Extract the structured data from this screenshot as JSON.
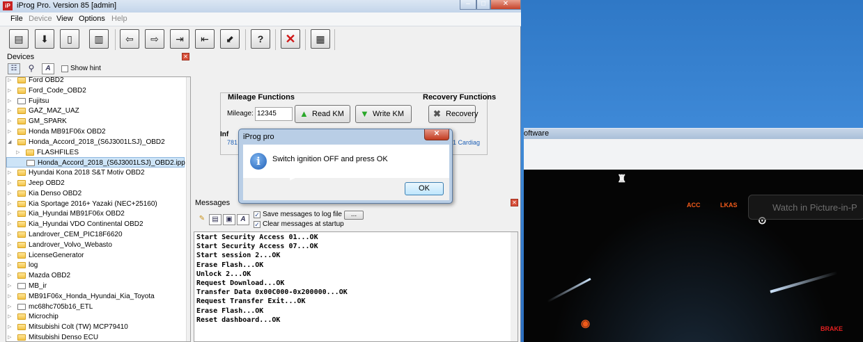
{
  "app": {
    "title": "iProg Pro. Version 85 [admin]",
    "icon_text": "iP"
  },
  "window_controls": {
    "minimize": "–",
    "maximize": "□",
    "close": "✕"
  },
  "menu": [
    "File",
    "Device",
    "View",
    "Options",
    "Help"
  ],
  "toolbar": {
    "icons": [
      "open-icon",
      "save-icon",
      "new-file-icon",
      "chip-icon",
      "read-icon",
      "write-icon",
      "edit-icon",
      "import-icon",
      "export-icon",
      "help-icon",
      "delete-icon",
      "calculator-icon"
    ],
    "help_glyph": "?",
    "delete_glyph": "✕"
  },
  "devices": {
    "header": "Devices",
    "show_hint": "Show hint",
    "items": [
      {
        "label": "Ford OBD2",
        "type": "folder",
        "indent": 0
      },
      {
        "label": "Ford_Code_OBD2",
        "type": "folder",
        "indent": 0
      },
      {
        "label": "Fujitsu",
        "type": "file",
        "indent": 0
      },
      {
        "label": "GAZ_MAZ_UAZ",
        "type": "folder",
        "indent": 0
      },
      {
        "label": "GM_SPARK",
        "type": "folder",
        "indent": 0
      },
      {
        "label": "Honda MB91F06x OBD2",
        "type": "folder",
        "indent": 0
      },
      {
        "label": "Honda_Accord_2018_(S6J3001LSJ)_OBD2",
        "type": "folder",
        "indent": 0,
        "expanded": true
      },
      {
        "label": "FLASHFILES",
        "type": "folder",
        "indent": 1
      },
      {
        "label": "Honda_Accord_2018_(S6J3001LSJ)_OBD2.ipp",
        "type": "ipp",
        "indent": 1,
        "selected": true
      },
      {
        "label": "Hyundai Kona 2018 S&T Motiv OBD2",
        "type": "folder",
        "indent": 0
      },
      {
        "label": "Jeep OBD2",
        "type": "folder",
        "indent": 0
      },
      {
        "label": "Kia Denso OBD2",
        "type": "folder",
        "indent": 0
      },
      {
        "label": "Kia Sportage 2016+ Yazaki (NEC+25160)",
        "type": "folder",
        "indent": 0
      },
      {
        "label": "Kia_Hyundai MB91F06x OBD2",
        "type": "folder",
        "indent": 0
      },
      {
        "label": "Kia_Hyundai VDO Continental OBD2",
        "type": "folder",
        "indent": 0
      },
      {
        "label": "Landrover_CEM_PIC18F6620",
        "type": "folder",
        "indent": 0
      },
      {
        "label": "Landrover_Volvo_Webasto",
        "type": "folder",
        "indent": 0
      },
      {
        "label": "LicenseGenerator",
        "type": "folder",
        "indent": 0
      },
      {
        "label": "log",
        "type": "folder",
        "indent": 0
      },
      {
        "label": "Mazda OBD2",
        "type": "folder",
        "indent": 0
      },
      {
        "label": "MB_ir",
        "type": "file",
        "indent": 0
      },
      {
        "label": "MB91F06x_Honda_Hyundai_Kia_Toyota",
        "type": "folder",
        "indent": 0
      },
      {
        "label": "mc68hc705b16_ETL",
        "type": "file",
        "indent": 0
      },
      {
        "label": "Microchip",
        "type": "folder",
        "indent": 0
      },
      {
        "label": "Mitsubishi Colt (TW) MCP79410",
        "type": "folder",
        "indent": 0
      },
      {
        "label": "Mitsubishi Denso ECU",
        "type": "folder",
        "indent": 0
      }
    ]
  },
  "mileage": {
    "header": "Mileage Functions",
    "label": "Mileage:",
    "value": "12345",
    "read_btn": "Read KM",
    "write_btn": "Write KM"
  },
  "recovery": {
    "header": "Recovery Functions",
    "btn": "Recovery"
  },
  "info": {
    "header": "Inf",
    "value_left": "781",
    "value_right": "1 Cardiag"
  },
  "messages": {
    "header": "Messages",
    "save_log": "Save messages to log file",
    "clear_on_start": "Clear messages at startup",
    "dots": "...",
    "lines": [
      "Start Security Access 01...OK",
      "Start Security Access 07...OK",
      "Start session 2...OK",
      "Erase Flash...OK",
      "Unlock 2...OK",
      "Request Download...OK",
      "Transfer Data 0x00C000-0x200000...OK",
      "Request Transfer Exit...OK",
      "Erase Flash...OK",
      "Reset dashboard...OK"
    ]
  },
  "dialog": {
    "title": "iProg pro",
    "message": "Switch ignition OFF and press OK",
    "ok": "OK",
    "info_glyph": "i"
  },
  "background_window": {
    "title": "oftware",
    "pip": "Watch in Picture-in-P",
    "lamps": [
      "ACC",
      "LKAS",
      "BRAKE"
    ]
  }
}
